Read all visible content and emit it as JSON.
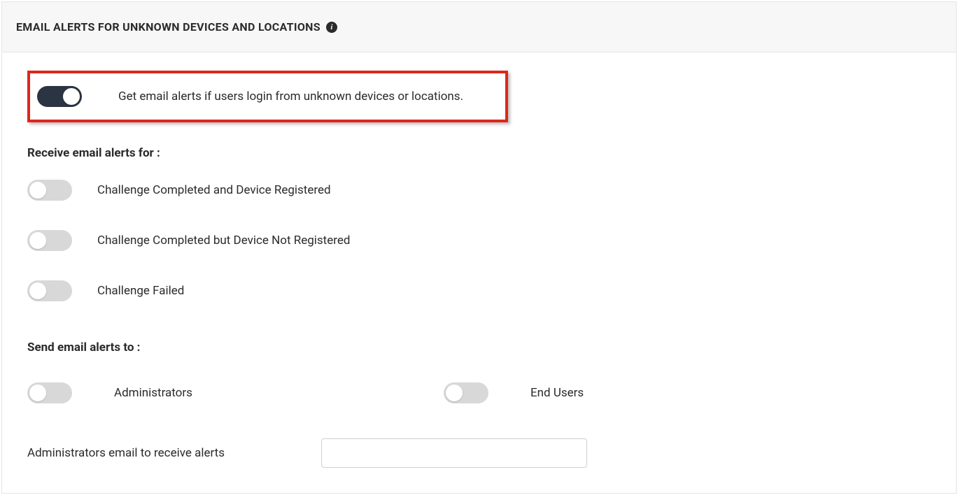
{
  "header": {
    "title": "EMAIL ALERTS FOR UNKNOWN DEVICES AND LOCATIONS"
  },
  "main_toggle": {
    "label": "Get email alerts if users login from unknown devices or locations."
  },
  "receive_section": {
    "title": "Receive email alerts for :",
    "options": [
      {
        "label": "Challenge Completed and Device Registered"
      },
      {
        "label": "Challenge Completed but Device Not Registered"
      },
      {
        "label": "Challenge Failed"
      }
    ]
  },
  "send_section": {
    "title": "Send email alerts to :",
    "recipients": [
      {
        "label": "Administrators"
      },
      {
        "label": "End Users"
      }
    ]
  },
  "admin_email": {
    "label": "Administrators email to receive alerts",
    "value": ""
  }
}
